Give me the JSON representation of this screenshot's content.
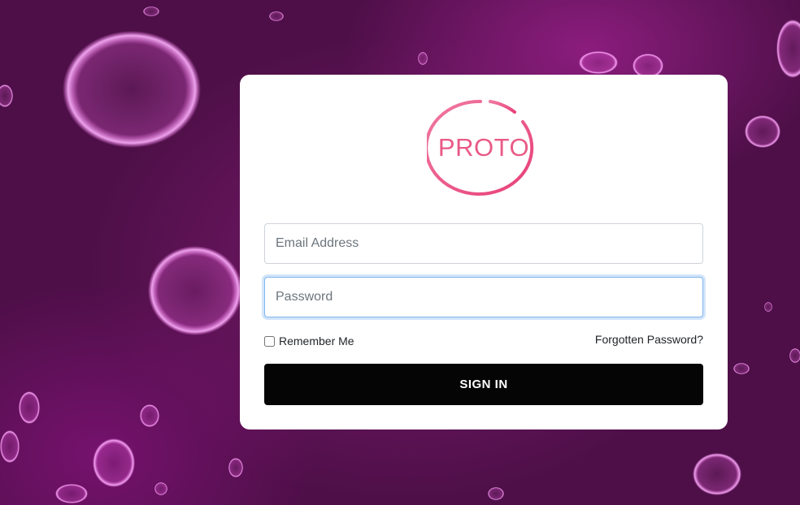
{
  "brand": {
    "logo_text": "PROTO",
    "logo_color": "#e95a86"
  },
  "form": {
    "email_placeholder": "Email Address",
    "email_value": "",
    "password_placeholder": "Password",
    "password_value": "",
    "remember_label": "Remember Me",
    "remember_checked": false,
    "forgot_label": "Forgotten Password?",
    "signin_label": "SIGN IN"
  },
  "colors": {
    "background": "#6a1560",
    "card": "#ffffff",
    "button": "#050505",
    "focus_border": "#7fb5ee"
  }
}
